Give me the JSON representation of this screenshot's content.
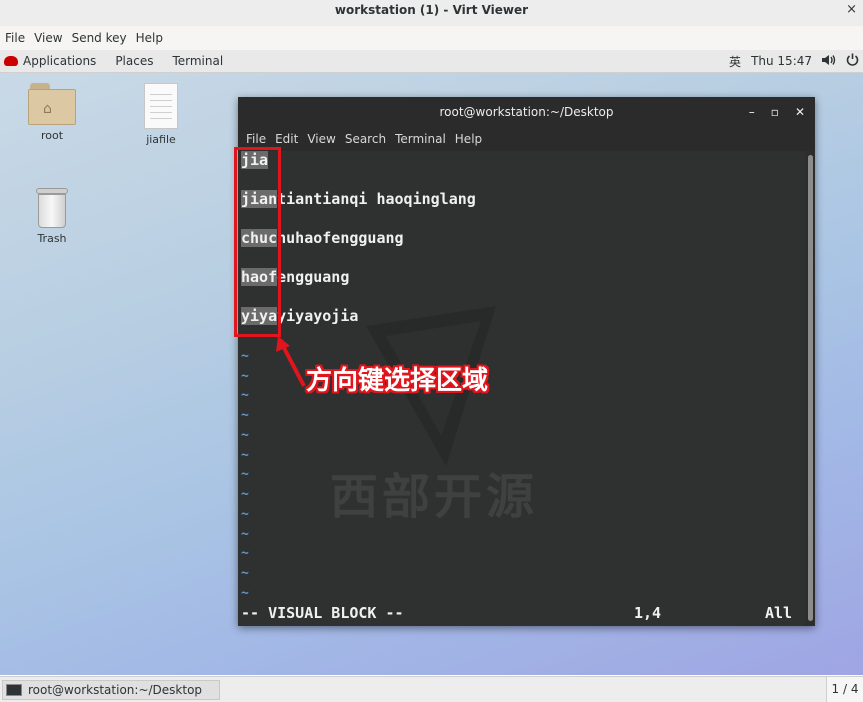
{
  "window": {
    "title": "workstation (1) - Virt Viewer",
    "close_glyph": "×"
  },
  "viewer_menu": [
    "File",
    "View",
    "Send key",
    "Help"
  ],
  "panel": {
    "applications": "Applications",
    "places": "Places",
    "terminal": "Terminal",
    "input_method": "英",
    "clock": "Thu 15:47",
    "volume_icon": "speaker-icon",
    "power_icon": "power-icon"
  },
  "desktop_icons": [
    {
      "label": "root",
      "icon": "home-folder-icon"
    },
    {
      "label": "jiafile",
      "icon": "text-file-icon"
    },
    {
      "label": "Trash",
      "icon": "trash-icon"
    }
  ],
  "terminal": {
    "title": "root@workstation:~/Desktop",
    "menu": [
      "File",
      "Edit",
      "View",
      "Search",
      "Terminal",
      "Help"
    ],
    "lines": [
      {
        "sel": "jia",
        "rest": ""
      },
      {
        "sel": "jian",
        "rest": "tiantianqi haoqinglang"
      },
      {
        "sel": "chuc",
        "rest": "huhaofengguang"
      },
      {
        "sel": "haof",
        "rest": "engguang"
      },
      {
        "sel": "yiya",
        "rest": "yiyayojia"
      }
    ],
    "tilde": "~",
    "mode": "-- VISUAL BLOCK --",
    "position": "1,4",
    "scroll": "All"
  },
  "watermark": "西部开源",
  "annotation": {
    "text": "方向键选择区域",
    "color": "#e1151c"
  },
  "taskbar": {
    "task_label": "root@workstation:~/Desktop",
    "workspace": "1 / 4"
  }
}
